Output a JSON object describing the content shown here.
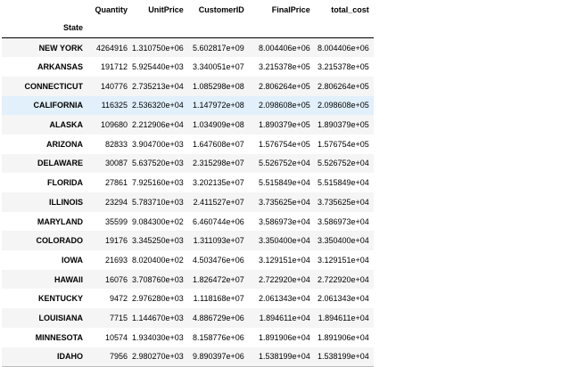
{
  "table": {
    "index_name": "State",
    "columns": [
      "Quantity",
      "UnitPrice",
      "CustomerID",
      "FinalPrice",
      "total_cost"
    ],
    "highlighted_row": 3,
    "rows": [
      {
        "state": "NEW YORK",
        "values": [
          "4264916",
          "1.310750e+06",
          "5.602817e+09",
          "8.004406e+06",
          "8.004406e+06"
        ]
      },
      {
        "state": "ARKANSAS",
        "values": [
          "191712",
          "5.925440e+03",
          "3.340051e+07",
          "3.215378e+05",
          "3.215378e+05"
        ]
      },
      {
        "state": "CONNECTICUT",
        "values": [
          "140776",
          "2.735213e+04",
          "1.085298e+08",
          "2.806264e+05",
          "2.806264e+05"
        ]
      },
      {
        "state": "CALIFORNIA",
        "values": [
          "116325",
          "2.536320e+04",
          "1.147972e+08",
          "2.098608e+05",
          "2.098608e+05"
        ]
      },
      {
        "state": "ALASKA",
        "values": [
          "109680",
          "2.212906e+04",
          "1.034909e+08",
          "1.890379e+05",
          "1.890379e+05"
        ]
      },
      {
        "state": "ARIZONA",
        "values": [
          "82833",
          "3.904700e+03",
          "1.647608e+07",
          "1.576754e+05",
          "1.576754e+05"
        ]
      },
      {
        "state": "DELAWARE",
        "values": [
          "30087",
          "5.637520e+03",
          "2.315298e+07",
          "5.526752e+04",
          "5.526752e+04"
        ]
      },
      {
        "state": "FLORIDA",
        "values": [
          "27861",
          "7.925160e+03",
          "3.202135e+07",
          "5.515849e+04",
          "5.515849e+04"
        ]
      },
      {
        "state": "ILLINOIS",
        "values": [
          "23294",
          "5.783710e+03",
          "2.411527e+07",
          "3.735625e+04",
          "3.735625e+04"
        ]
      },
      {
        "state": "MARYLAND",
        "values": [
          "35599",
          "9.084300e+02",
          "6.460744e+06",
          "3.586973e+04",
          "3.586973e+04"
        ]
      },
      {
        "state": "COLORADO",
        "values": [
          "19176",
          "3.345250e+03",
          "1.311093e+07",
          "3.350400e+04",
          "3.350400e+04"
        ]
      },
      {
        "state": "IOWA",
        "values": [
          "21693",
          "8.020400e+02",
          "4.503476e+06",
          "3.129151e+04",
          "3.129151e+04"
        ]
      },
      {
        "state": "HAWAII",
        "values": [
          "16076",
          "3.708760e+03",
          "1.826472e+07",
          "2.722920e+04",
          "2.722920e+04"
        ]
      },
      {
        "state": "KENTUCKY",
        "values": [
          "9472",
          "2.976280e+03",
          "1.118168e+07",
          "2.061343e+04",
          "2.061343e+04"
        ]
      },
      {
        "state": "LOUISIANA",
        "values": [
          "7715",
          "1.144670e+03",
          "4.886729e+06",
          "1.894611e+04",
          "1.894611e+04"
        ]
      },
      {
        "state": "MINNESOTA",
        "values": [
          "10574",
          "1.934030e+03",
          "8.158776e+06",
          "1.891906e+04",
          "1.891906e+04"
        ]
      },
      {
        "state": "IDAHO",
        "values": [
          "7956",
          "2.980270e+03",
          "9.890397e+06",
          "1.538199e+04",
          "1.538199e+04"
        ]
      }
    ]
  }
}
